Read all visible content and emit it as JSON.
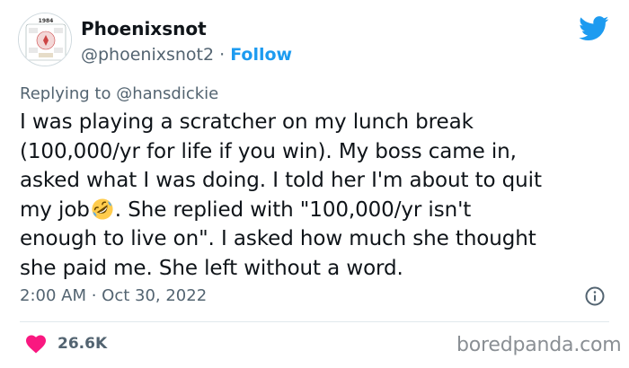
{
  "author": {
    "name": "Phoenixsnot",
    "handle": "@phoenixsnot2",
    "separator": " · ",
    "follow_label": "Follow",
    "avatar": {
      "year": "1984"
    }
  },
  "reply": {
    "prefix": "Replying to ",
    "handle": "@hansdickie"
  },
  "tweet": {
    "lines": [
      "I was playing a scratcher on my lunch break",
      "(100,000/yr for life if you win). My boss came in,",
      "asked what I was doing. I told her I'm about to quit",
      "my job",
      ". She replied with \"100,000/yr isn't",
      "enough to live on\". I asked how much she thought",
      "she paid me. She left without a word."
    ],
    "emoji": "rolling-on-floor-laughing"
  },
  "meta": {
    "timestamp": "2:00 AM · Oct 30, 2022"
  },
  "engagement": {
    "likes": "26.6K"
  },
  "watermark": "boredpanda.com",
  "colors": {
    "twitter_blue": "#1d9bf0",
    "heart_red": "#f91880",
    "text_primary": "#0f1419",
    "text_secondary": "#536471"
  },
  "icons": [
    "twitter-bird-icon",
    "info-icon",
    "heart-icon",
    "emoji-rofl-icon"
  ]
}
